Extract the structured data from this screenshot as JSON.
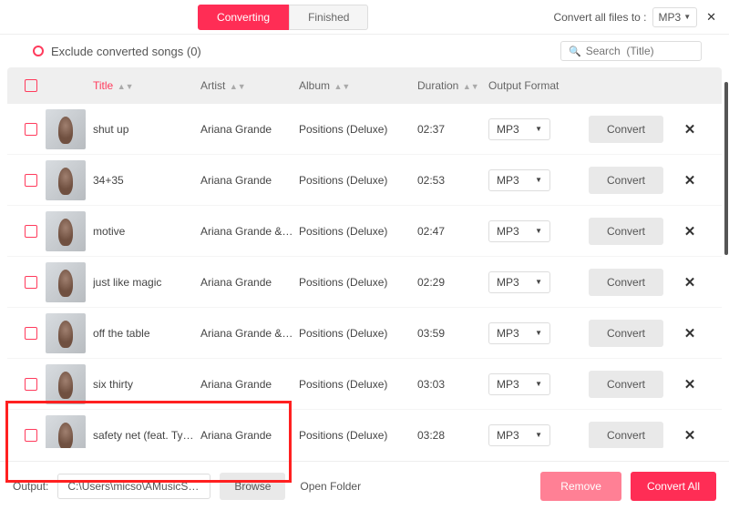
{
  "tabs": {
    "converting": "Converting",
    "finished": "Finished"
  },
  "convert_all_label": "Convert all files to :",
  "global_format": "MP3",
  "exclude_label": "Exclude converted songs (0)",
  "search_placeholder": "Search  (Title)",
  "headers": {
    "title": "Title",
    "artist": "Artist",
    "album": "Album",
    "duration": "Duration",
    "output_format": "Output Format"
  },
  "tracks": [
    {
      "title": "shut up",
      "artist": "Ariana Grande",
      "album": "Positions (Deluxe)",
      "duration": "02:37",
      "fmt": "MP3"
    },
    {
      "title": "34+35",
      "artist": "Ariana Grande",
      "album": "Positions (Deluxe)",
      "duration": "02:53",
      "fmt": "MP3"
    },
    {
      "title": "motive",
      "artist": "Ariana Grande & …",
      "album": "Positions (Deluxe)",
      "duration": "02:47",
      "fmt": "MP3"
    },
    {
      "title": "just like magic",
      "artist": "Ariana Grande",
      "album": "Positions (Deluxe)",
      "duration": "02:29",
      "fmt": "MP3"
    },
    {
      "title": "off the table",
      "artist": "Ariana Grande & …",
      "album": "Positions (Deluxe)",
      "duration": "03:59",
      "fmt": "MP3"
    },
    {
      "title": "six thirty",
      "artist": "Ariana Grande",
      "album": "Positions (Deluxe)",
      "duration": "03:03",
      "fmt": "MP3"
    },
    {
      "title": "safety net (feat. Ty …",
      "artist": "Ariana Grande",
      "album": "Positions (Deluxe)",
      "duration": "03:28",
      "fmt": "MP3"
    }
  ],
  "convert_btn": "Convert",
  "output_label": "Output:",
  "output_path": "C:\\Users\\micso\\AMusicSoft …",
  "browse": "Browse",
  "open_folder": "Open Folder",
  "remove": "Remove",
  "convert_all_btn": "Convert All"
}
